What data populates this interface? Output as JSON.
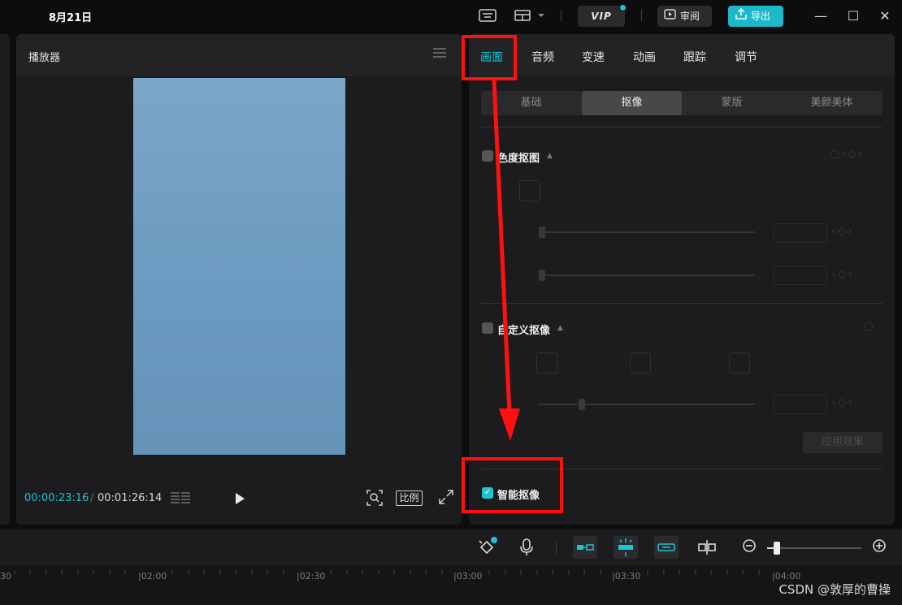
{
  "titlebar": {
    "title": "8月21日",
    "vip_label": "VIP",
    "review_label": "审阅",
    "export_label": "导出",
    "win_minimize": "—",
    "win_maximize": "☐",
    "win_close": "✕"
  },
  "player": {
    "title": "播放器",
    "current_time": "00:00:23:16",
    "separator": "/",
    "total_time": "00:01:26:14",
    "ratio_label": "比例"
  },
  "panel": {
    "tabs": [
      {
        "label": "画面",
        "active": true
      },
      {
        "label": "音频",
        "active": false
      },
      {
        "label": "变速",
        "active": false
      },
      {
        "label": "动画",
        "active": false
      },
      {
        "label": "跟踪",
        "active": false
      },
      {
        "label": "调节",
        "active": false
      }
    ],
    "subtabs": [
      {
        "label": "基础",
        "active": false
      },
      {
        "label": "抠像",
        "active": true
      },
      {
        "label": "蒙版",
        "active": false
      },
      {
        "label": "美颜美体",
        "active": false
      }
    ],
    "chroma_key": {
      "label": "色度抠图",
      "checked": false
    },
    "custom_key": {
      "label": "自定义抠像",
      "checked": false
    },
    "apply_label": "应用效果",
    "smart_key": {
      "label": "智能抠像",
      "checked": true
    }
  },
  "timeline": {
    "ticks": [
      "|02:00",
      "|02:30",
      "|03:00",
      "|03:30",
      "|04:00"
    ],
    "edge_tick": "30"
  },
  "watermark": "CSDN @敦厚的曹操",
  "colors": {
    "accent": "#1ec3d4",
    "annotation": "#ff1010"
  }
}
